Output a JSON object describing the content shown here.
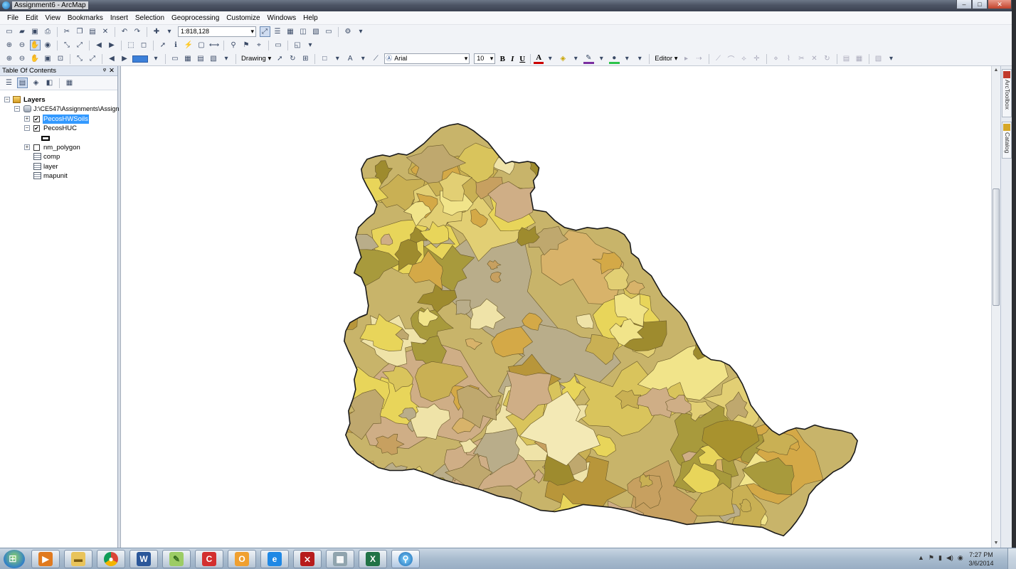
{
  "window": {
    "title": "Assignment6 - ArcMap",
    "controls": {
      "minimize": "–",
      "maximize": "□",
      "close": "✕"
    }
  },
  "menu": [
    "File",
    "Edit",
    "View",
    "Bookmarks",
    "Insert",
    "Selection",
    "Geoprocessing",
    "Customize",
    "Windows",
    "Help"
  ],
  "toolbar": {
    "scale": "1:818,128",
    "drawing_label": "Drawing ▾",
    "font_name": "Arial",
    "font_size": "10",
    "bold": "B",
    "italic": "I",
    "underline": "U",
    "font_color": "A",
    "editor_label": "Editor ▾"
  },
  "toc": {
    "title": "Table Of Contents",
    "pin": "ᵠ",
    "close": "✕",
    "root": "Layers",
    "path": "J:\\CE547\\Assignments\\Assign",
    "layers": [
      {
        "name": "PecosHWSoils",
        "checked": true,
        "selected": true,
        "expanded": false
      },
      {
        "name": "PecosHUC",
        "checked": true,
        "selected": false,
        "expanded": true
      },
      {
        "name": "nm_polygon",
        "checked": false,
        "selected": false,
        "expanded": false
      }
    ],
    "tables": [
      "comp",
      "layer",
      "mapunit"
    ]
  },
  "right_dock": [
    "ArcToolbox",
    "Catalog"
  ],
  "taskbar": {
    "apps": [
      "windows-media-player",
      "windows-explorer",
      "google-chrome",
      "microsoft-word",
      "paint-tool",
      "ccleaner",
      "outlook-calendar",
      "internet-explorer",
      "adobe-acrobat",
      "calculator",
      "microsoft-excel",
      "arcmap"
    ],
    "time": "7:27 PM",
    "date": "3/6/2014"
  },
  "map_colors": {
    "outline": "#1a1a1a",
    "palette": [
      "#c9b054",
      "#d9c45c",
      "#e8d55a",
      "#f1e48a",
      "#b9ad8a",
      "#a89a3c",
      "#d8b36a",
      "#c7a060",
      "#efe3a8",
      "#b8963a",
      "#9e8b2e",
      "#d4a947",
      "#e2cf74",
      "#cfae86",
      "#bfa86e"
    ]
  }
}
